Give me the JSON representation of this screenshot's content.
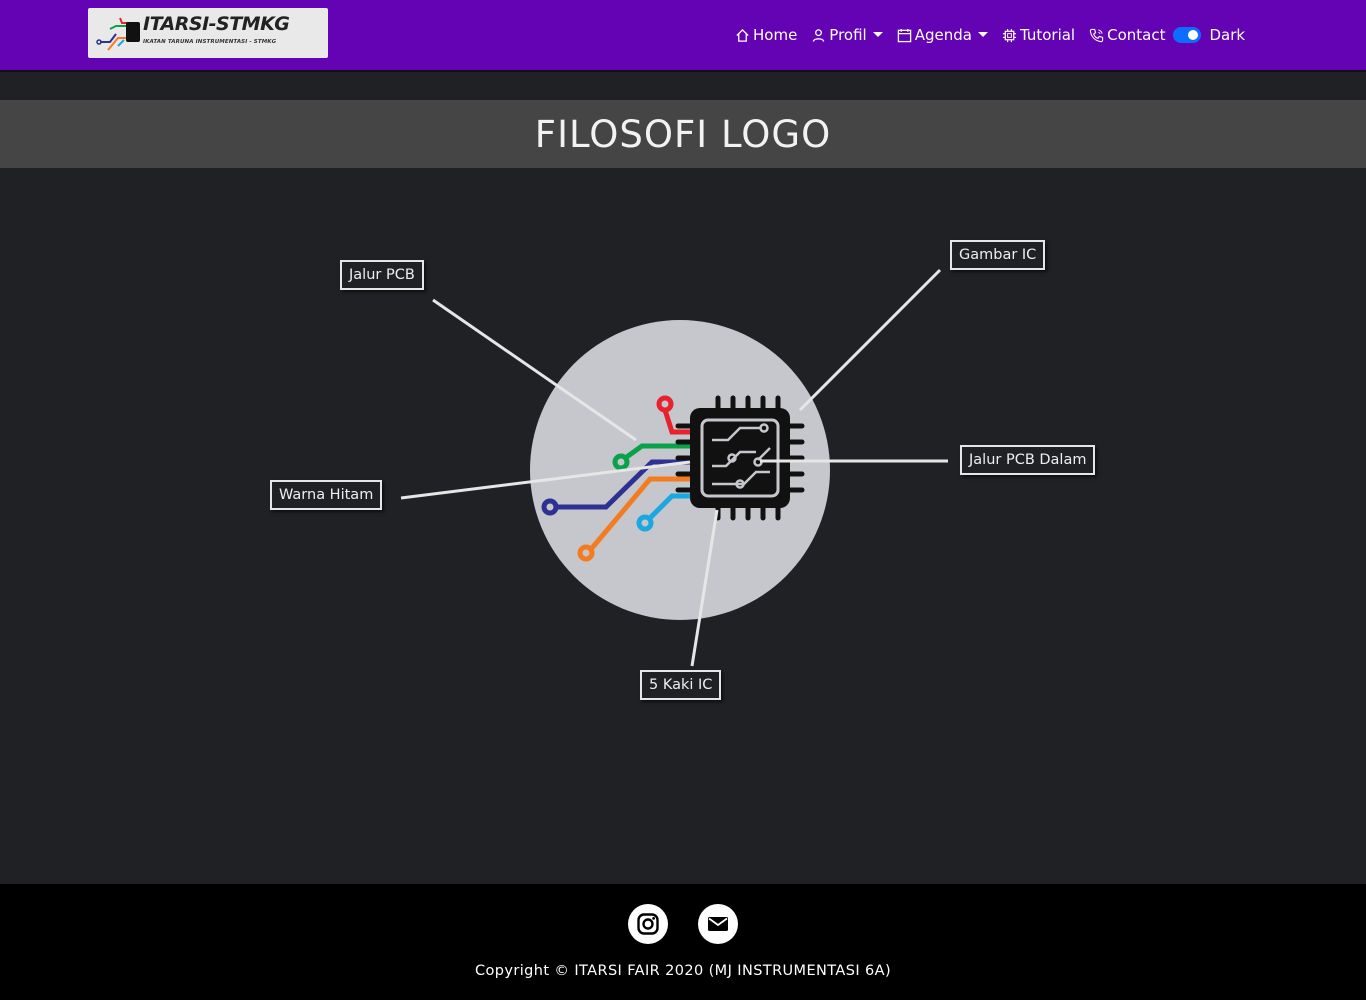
{
  "brand": {
    "title": "ITARSI-STMKG",
    "subtitle": "IKATAN TARUNA INSTRUMENTASI - STMKG"
  },
  "nav": {
    "home": "Home",
    "profil": "Profil",
    "agenda": "Agenda",
    "tutorial": "Tutorial",
    "contact": "Contact",
    "dark_label": "Dark",
    "dark_enabled": true
  },
  "page": {
    "title": "FILOSOFI LOGO"
  },
  "diagram": {
    "labels": {
      "jalur_pcb": "Jalur PCB",
      "gambar_ic": "Gambar IC",
      "warna_hitam": "Warna Hitam",
      "jalur_pcb_dalam": "Jalur PCB Dalam",
      "kaki_ic": "5 Kaki IC"
    }
  },
  "colors": {
    "navbar": "#6303b4",
    "background": "#202125",
    "title_band": "#454545",
    "toggle": "#0d6efd",
    "trace_red": "#e8212c",
    "trace_green": "#0aa14b",
    "trace_navy": "#2e3191",
    "trace_orange": "#f47c20",
    "trace_cyan": "#1aa8e0"
  },
  "footer": {
    "icons": [
      "instagram-icon",
      "mail-icon"
    ],
    "copyright": "Copyright © ITARSI FAIR 2020 (MJ INSTRUMENTASI 6A)"
  }
}
